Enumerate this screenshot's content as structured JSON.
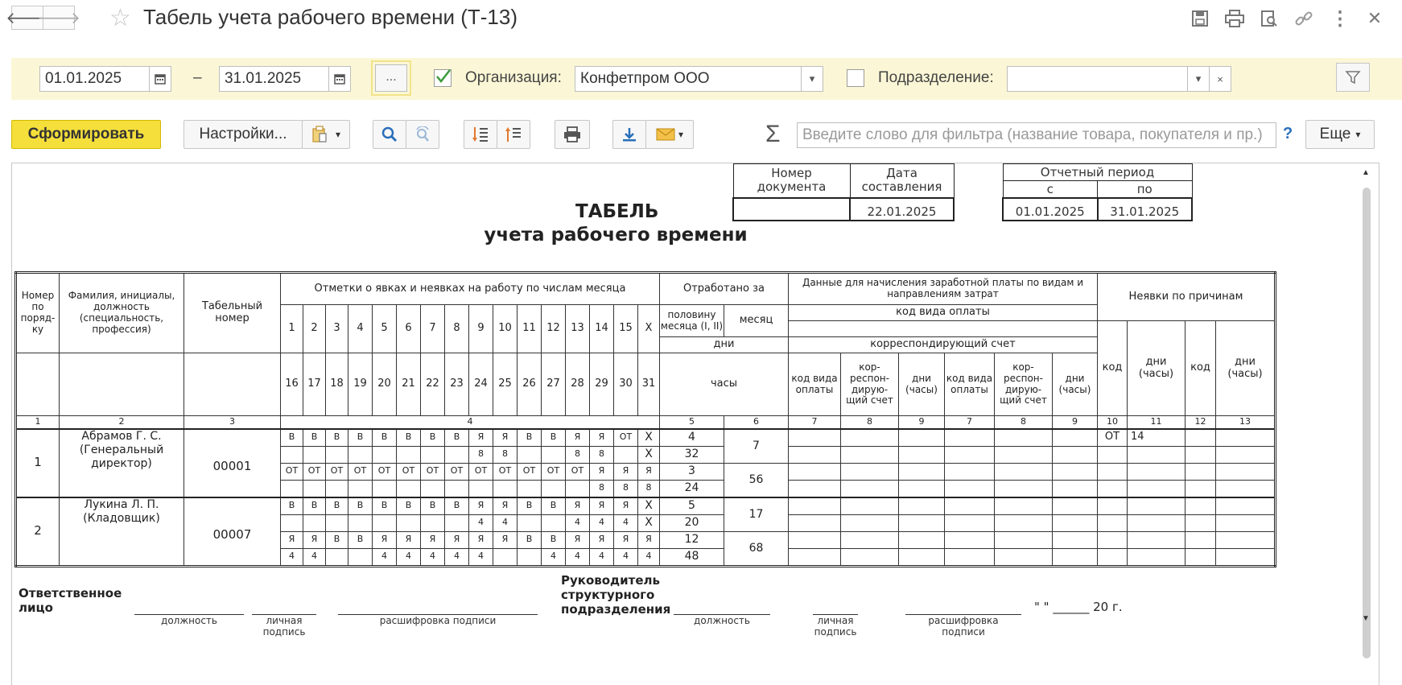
{
  "window": {
    "title": "Табель учета рабочего времени (Т-13)",
    "back_icon": "🡐",
    "forward_icon": "🡒",
    "star_icon": "☆",
    "close_icon": "✕",
    "more_icon": "⋮"
  },
  "filters": {
    "date_from": "01.01.2025",
    "dash": "–",
    "date_to": "31.01.2025",
    "ellipsis": "...",
    "org_label": "Организация:",
    "org_value": "Конфетпром ООО",
    "dept_label": "Подразделение:",
    "dept_value": "",
    "clear_icon": "×"
  },
  "toolbar": {
    "generate": "Сформировать",
    "settings": "Настройки...",
    "sigma": "Σ",
    "search_placeholder": "Введите слово для фильтра (название товара, покупателя и пр.)",
    "help": "?",
    "more": "Еще"
  },
  "doc": {
    "title1": "ТАБЕЛЬ",
    "title2": "учета  рабочего времени",
    "doc_number_label": "Номер\nдокумента",
    "doc_date_label": "Дата\nсоставления",
    "doc_date": "22.01.2025",
    "period_label": "Отчетный период",
    "period_from_label": "с",
    "period_to_label": "по",
    "period_from": "01.01.2025",
    "period_to": "31.01.2025"
  },
  "grid_headers": {
    "num": "Номер по поряд-ку",
    "fio": "Фамилия, инициалы, должность (специальность, профессия)",
    "tab": "Табельный номер",
    "marks": "Отметки о явках и неявках на работу по числам месяца",
    "worked": "Отработано за",
    "half": "половину месяца (I, II)",
    "month": "месяц",
    "days": "дни",
    "hours": "часы",
    "pay": "Данные для начисления заработной платы по видам и направлениям затрат",
    "paycode": "код вида оплаты",
    "corr": "корреспондирующий счет",
    "code_pay": "код вида оплаты",
    "corr_short": "кор-респон-дирую-щий счет",
    "days_hours": "дни (часы)",
    "absence": "Неявки по причинам",
    "code": "код",
    "x": "X",
    "days1": [
      "1",
      "2",
      "3",
      "4",
      "5",
      "6",
      "7",
      "8",
      "9",
      "10",
      "11",
      "12",
      "13",
      "14",
      "15"
    ],
    "days2": [
      "16",
      "17",
      "18",
      "19",
      "20",
      "21",
      "22",
      "23",
      "24",
      "25",
      "26",
      "27",
      "28",
      "29",
      "30",
      "31"
    ],
    "colnums": [
      "1",
      "2",
      "3",
      "4",
      "5",
      "6",
      "7",
      "8",
      "9",
      "7",
      "8",
      "9",
      "10",
      "11",
      "12",
      "13"
    ]
  },
  "employees": [
    {
      "num": "1",
      "fio": "Абрамов Г. С. (Генеральный директор)",
      "tab": "00001",
      "r1": [
        "В",
        "В",
        "В",
        "В",
        "В",
        "В",
        "В",
        "В",
        "Я",
        "Я",
        "В",
        "В",
        "Я",
        "Я",
        "ОТ",
        "X"
      ],
      "r2": [
        "",
        "",
        "",
        "",
        "",
        "",
        "",
        "",
        "8",
        "8",
        "",
        "",
        "8",
        "8",
        "",
        "X"
      ],
      "r3": [
        "ОТ",
        "ОТ",
        "ОТ",
        "ОТ",
        "ОТ",
        "ОТ",
        "ОТ",
        "ОТ",
        "ОТ",
        "ОТ",
        "ОТ",
        "ОТ",
        "ОТ",
        "Я",
        "Я",
        "Я"
      ],
      "r4": [
        "",
        "",
        "",
        "",
        "",
        "",
        "",
        "",
        "",
        "",
        "",
        "",
        "",
        "8",
        "8",
        "8"
      ],
      "half1_days": "4",
      "half1_hours": "32",
      "half2_days": "3",
      "half2_hours": "24",
      "month_days1": "7",
      "month_days2": "56",
      "abs_code": "ОТ",
      "abs_days": "14"
    },
    {
      "num": "2",
      "fio": "Лукина Л. П. (Кладовщик)",
      "tab": "00007",
      "r1": [
        "В",
        "В",
        "В",
        "В",
        "В",
        "В",
        "В",
        "В",
        "Я",
        "Я",
        "В",
        "В",
        "Я",
        "Я",
        "Я",
        "X"
      ],
      "r2": [
        "",
        "",
        "",
        "",
        "",
        "",
        "",
        "",
        "4",
        "4",
        "",
        "",
        "4",
        "4",
        "4",
        "X"
      ],
      "r3": [
        "Я",
        "Я",
        "В",
        "В",
        "Я",
        "Я",
        "Я",
        "Я",
        "Я",
        "Я",
        "В",
        "В",
        "Я",
        "Я",
        "Я",
        "Я"
      ],
      "r4": [
        "4",
        "4",
        "",
        "",
        "4",
        "4",
        "4",
        "4",
        "4",
        "",
        "",
        "4",
        "4",
        "4",
        "4",
        "4"
      ],
      "half1_days": "5",
      "half1_hours": "20",
      "half2_days": "12",
      "half2_hours": "48",
      "month_days1": "17",
      "month_days2": "68",
      "abs_code": "",
      "abs_days": ""
    }
  ],
  "footer": {
    "responsible": "Ответственное\nлицо",
    "head": "Руководитель\nструктурного\nподразделения",
    "position": "должность",
    "signature": "личная\nподпись",
    "decoding": "расшифровка подписи",
    "date_tail": "\" \" ______ 20   г."
  }
}
